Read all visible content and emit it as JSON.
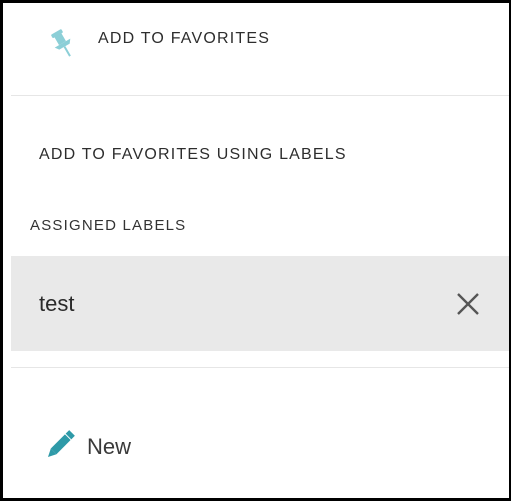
{
  "menu": {
    "add_to_favorites": {
      "label": "ADD TO FAVORITES",
      "icon": "pushpin-icon"
    },
    "add_using_labels": {
      "label": "ADD TO FAVORITES USING LABELS"
    }
  },
  "assigned_labels": {
    "heading": "ASSIGNED LABELS",
    "items": [
      {
        "name": "test",
        "remove_icon": "close-icon"
      }
    ]
  },
  "new_label": {
    "label": "New",
    "icon": "pencil-icon"
  },
  "colors": {
    "accent": "#2e9aa8",
    "pin": "#8ccfd7",
    "row_background": "#e9e9e9",
    "divider": "#e6e6e6"
  }
}
